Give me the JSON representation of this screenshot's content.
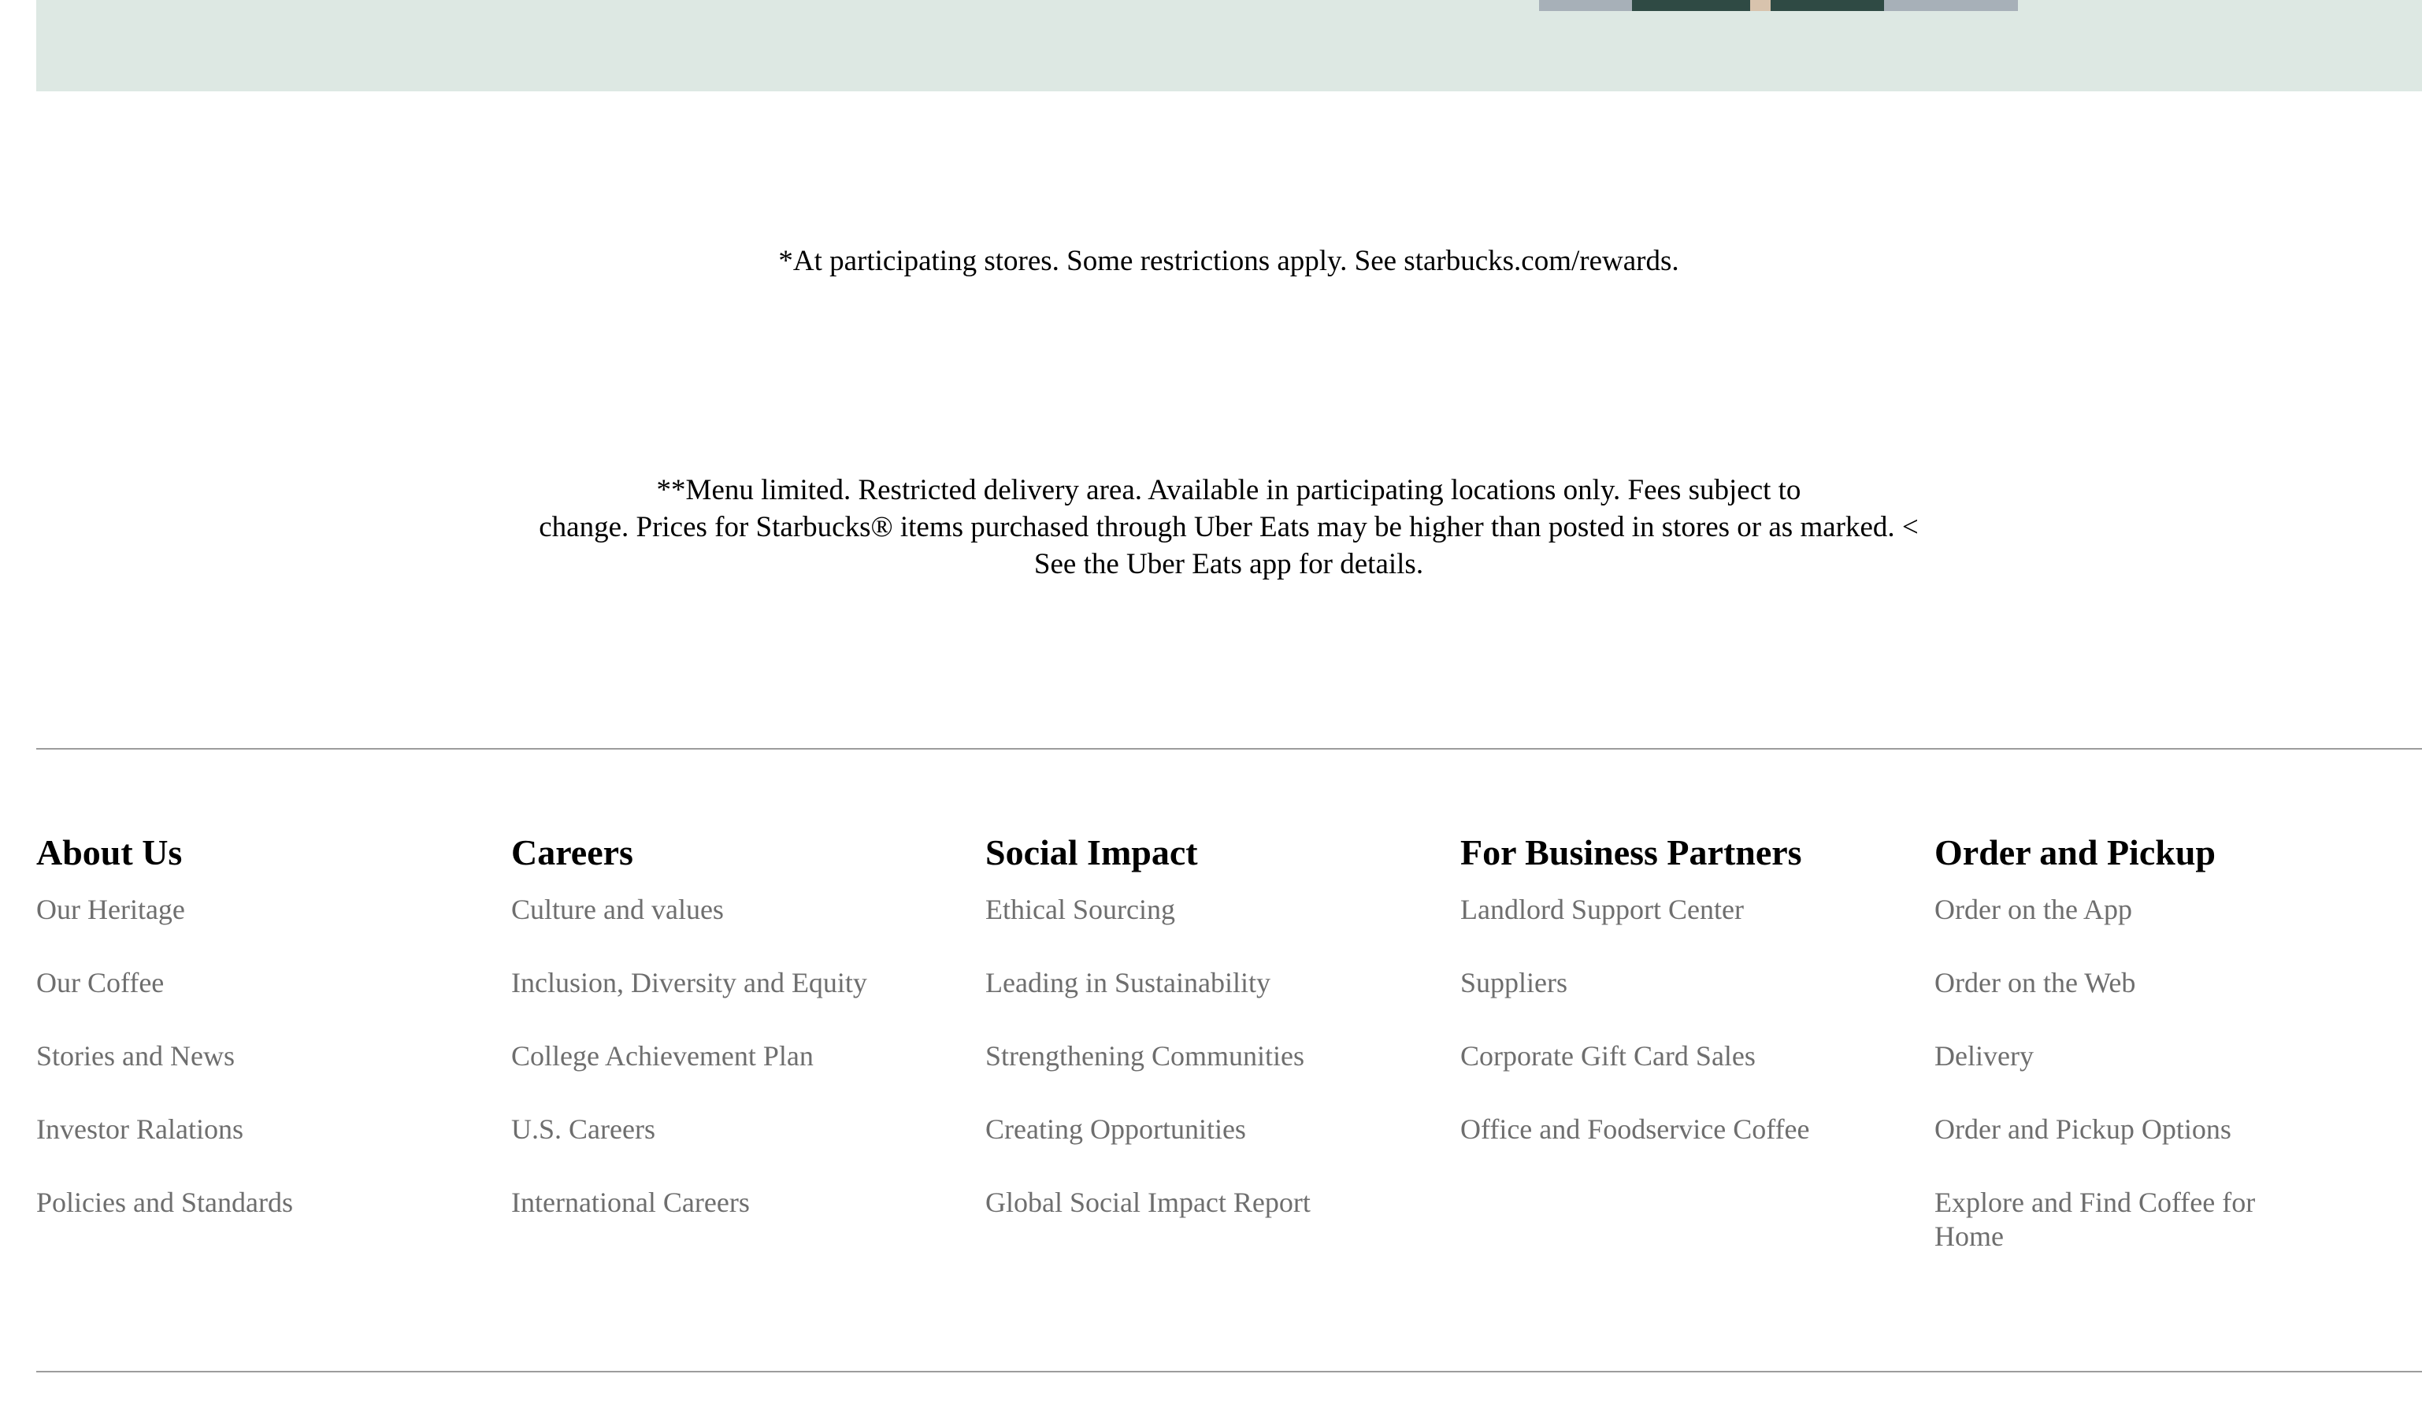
{
  "disclaimers": {
    "rewards": "*At participating stores. Some restrictions apply. See starbucks.com/rewards.",
    "uber_line1": "**Menu limited. Restricted delivery area. Available in participating locations only. Fees subject to",
    "uber_line2": "change. Prices for Starbucks® items purchased through Uber Eats may be higher than posted in stores or as marked. <",
    "uber_line3": "See the Uber Eats app for details."
  },
  "footer": {
    "columns": [
      {
        "heading": "About Us",
        "links": [
          "Our Heritage",
          "Our Coffee",
          "Stories and News",
          "Investor Ralations",
          "Policies and Standards"
        ]
      },
      {
        "heading": "Careers",
        "links": [
          "Culture and values",
          "Inclusion, Diversity and Equity",
          "College Achievement Plan",
          "U.S. Careers",
          "International Careers"
        ]
      },
      {
        "heading": "Social Impact",
        "links": [
          "Ethical Sourcing",
          "Leading in Sustainability",
          "Strengthening Communities",
          "Creating Opportunities",
          "Global Social Impact Report"
        ]
      },
      {
        "heading": "For Business Partners",
        "links": [
          "Landlord Support Center",
          "Suppliers",
          "Corporate Gift Card Sales",
          "Office and Foodservice Coffee"
        ]
      },
      {
        "heading": "Order and Pickup",
        "links": [
          "Order on the App",
          "Order on the Web",
          "Delivery",
          "Order and Pickup Options",
          "Explore and Find Coffee for Home"
        ]
      }
    ]
  }
}
